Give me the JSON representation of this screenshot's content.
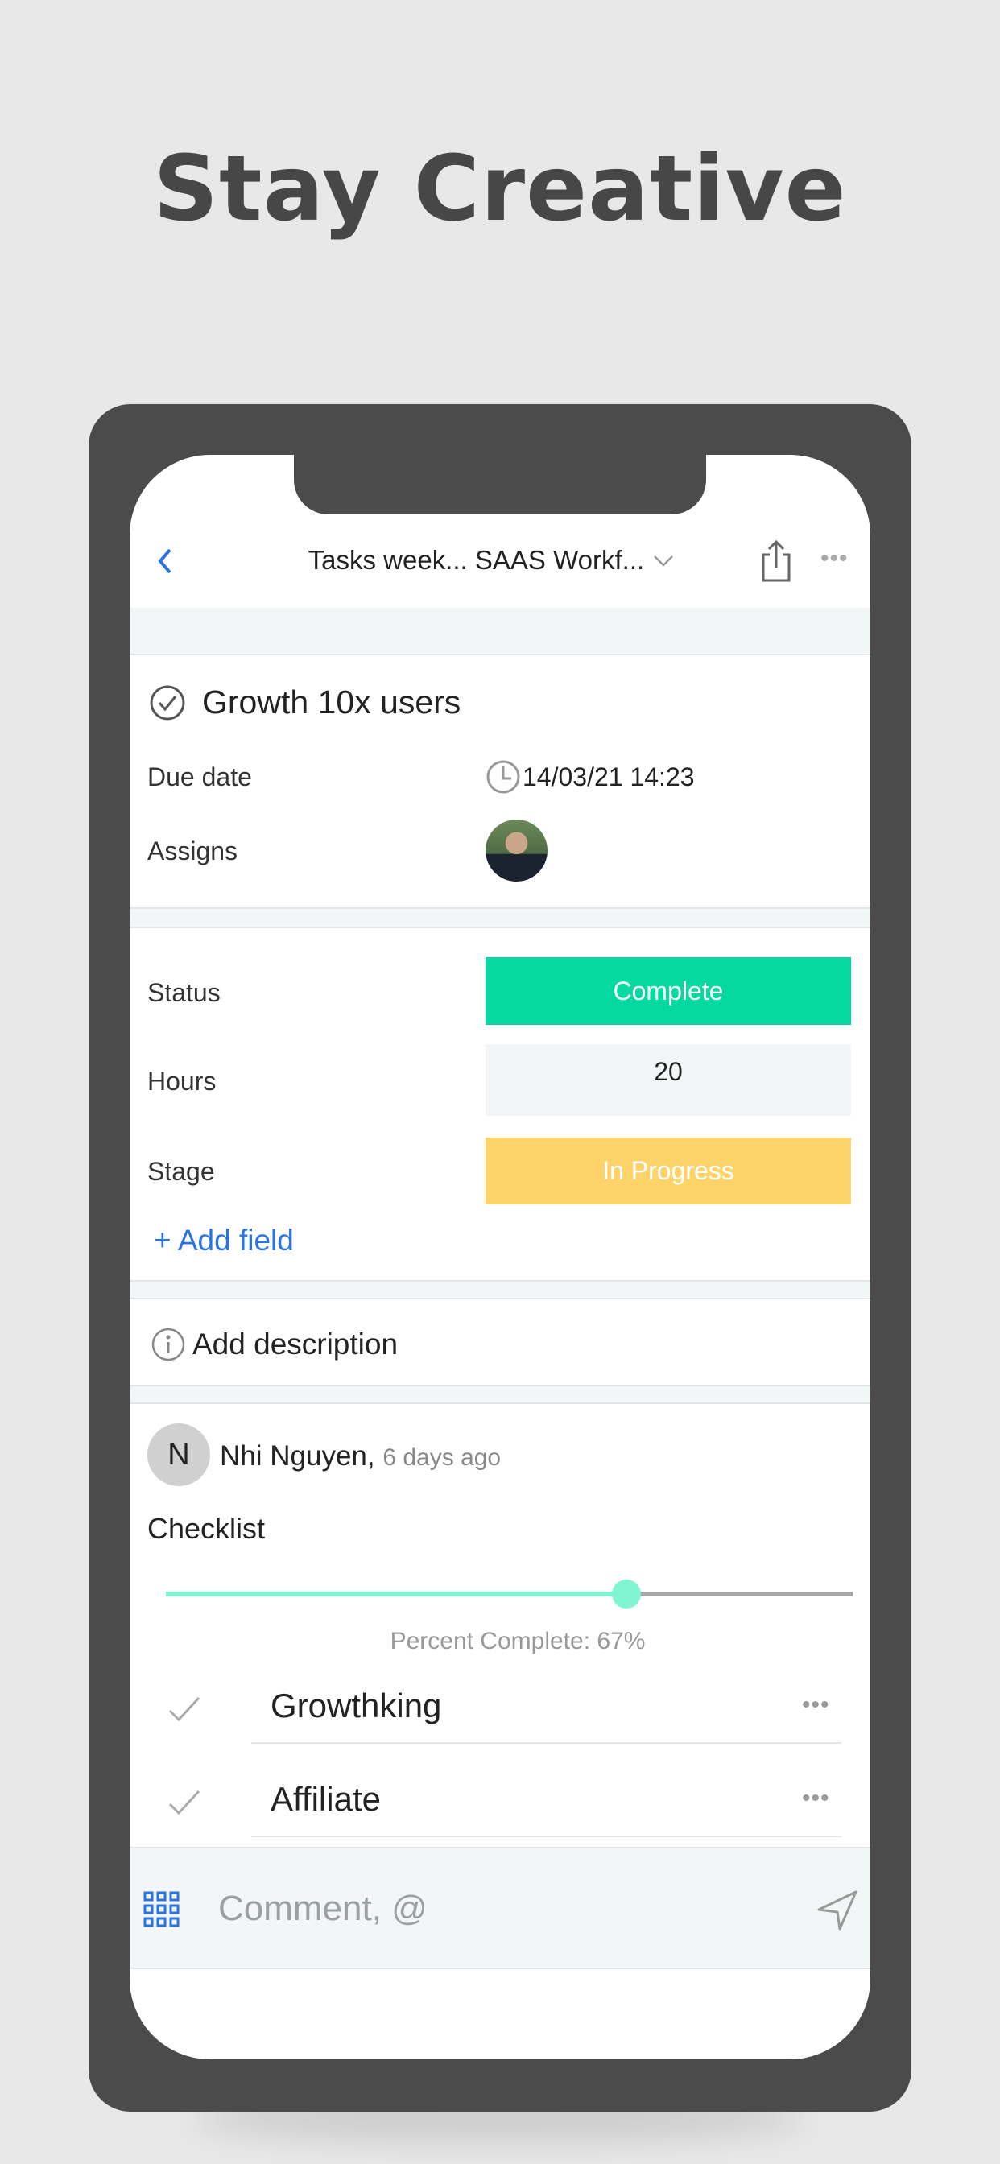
{
  "headline": "Stay Creative",
  "header": {
    "title": "Tasks week... SAAS Workf...",
    "back_icon": "chevron-left-icon",
    "share_icon": "share-icon",
    "more_icon": "more-dots-icon"
  },
  "task": {
    "title": "Growth 10x users",
    "due_label": "Due date",
    "due_value": "14/03/21 14:23",
    "assigns_label": "Assigns"
  },
  "fields": {
    "status_label": "Status",
    "status_value": "Complete",
    "status_color": "#05d9a0",
    "hours_label": "Hours",
    "hours_value": "20",
    "stage_label": "Stage",
    "stage_value": "In Progress",
    "stage_color": "#fed46a",
    "add_field": "+ Add field"
  },
  "description": {
    "label": "Add description"
  },
  "activity": {
    "avatar_initial": "N",
    "author": "Nhi Nguyen,",
    "time": "6 days ago",
    "checklist_title": "Checklist",
    "percent": 67,
    "percent_text": "Percent Complete: 67%",
    "items": [
      {
        "label": "Growthking",
        "done": true
      },
      {
        "label": "Affiliate",
        "done": true
      }
    ]
  },
  "comment": {
    "placeholder": "Comment, @"
  },
  "colors": {
    "accent": "#2a73e0",
    "slider": "#7ff5d1"
  }
}
